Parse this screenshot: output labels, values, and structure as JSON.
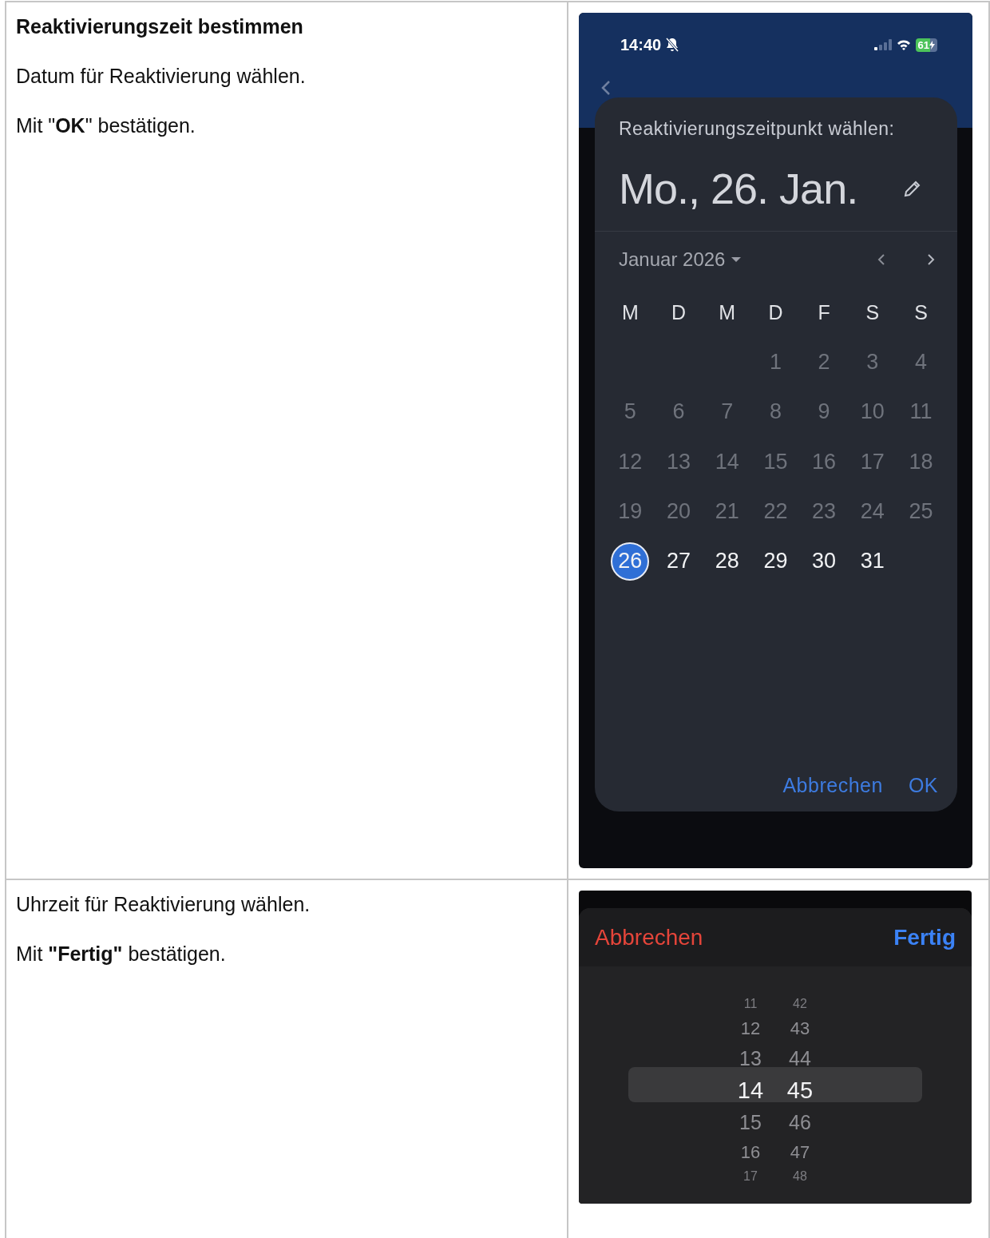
{
  "steps": [
    {
      "kind": "date",
      "heading": "Reaktivierungszeit bestimmen",
      "paragraphs": [
        "Datum für Reaktivierung wählen.",
        "Mit \"**OK**\" bestätigen."
      ],
      "phone": {
        "status_time": "14:40",
        "battery": "61",
        "dialog": {
          "title": "Reaktivierungszeitpunkt wählen:",
          "date": "Mo., 26. Jan.",
          "month": "Januar 2026",
          "weekdays": [
            "M",
            "D",
            "M",
            "D",
            "F",
            "S",
            "S"
          ],
          "weeks": [
            [
              {
                "day": "1",
                "disabled": true,
                "selected": false
              },
              {
                "day": "2",
                "disabled": true,
                "selected": false
              },
              {
                "day": "3",
                "disabled": true,
                "selected": false
              },
              {
                "day": "4",
                "disabled": true,
                "selected": false
              }
            ],
            [
              {
                "day": "5",
                "disabled": true,
                "selected": false
              },
              {
                "day": "6",
                "disabled": true,
                "selected": false
              },
              {
                "day": "7",
                "disabled": true,
                "selected": false
              },
              {
                "day": "8",
                "disabled": true,
                "selected": false
              },
              {
                "day": "9",
                "disabled": true,
                "selected": false
              },
              {
                "day": "10",
                "disabled": true,
                "selected": false
              },
              {
                "day": "11",
                "disabled": true,
                "selected": false
              }
            ],
            [
              {
                "day": "12",
                "disabled": true,
                "selected": false
              },
              {
                "day": "13",
                "disabled": true,
                "selected": false
              },
              {
                "day": "14",
                "disabled": true,
                "selected": false
              },
              {
                "day": "15",
                "disabled": true,
                "selected": false
              },
              {
                "day": "16",
                "disabled": true,
                "selected": false
              },
              {
                "day": "17",
                "disabled": true,
                "selected": false
              },
              {
                "day": "18",
                "disabled": true,
                "selected": false
              }
            ],
            [
              {
                "day": "19",
                "disabled": true,
                "selected": false
              },
              {
                "day": "20",
                "disabled": true,
                "selected": false
              },
              {
                "day": "21",
                "disabled": true,
                "selected": false
              },
              {
                "day": "22",
                "disabled": true,
                "selected": false
              },
              {
                "day": "23",
                "disabled": true,
                "selected": false
              },
              {
                "day": "24",
                "disabled": true,
                "selected": false
              },
              {
                "day": "25",
                "disabled": true,
                "selected": false
              }
            ],
            [
              {
                "day": "26",
                "disabled": false,
                "selected": true
              },
              {
                "day": "27",
                "disabled": false,
                "selected": false
              },
              {
                "day": "28",
                "disabled": false,
                "selected": false
              },
              {
                "day": "29",
                "disabled": false,
                "selected": false
              },
              {
                "day": "30",
                "disabled": false,
                "selected": false
              },
              {
                "day": "31",
                "disabled": false,
                "selected": false
              }
            ]
          ],
          "buttons": [
            "Abbrechen",
            "OK"
          ]
        }
      }
    },
    {
      "kind": "time",
      "paragraphs": [
        "Uhrzeit für Reaktivierung wählen.",
        "Mit **\"Fertig\"** bestätigen."
      ],
      "picker": {
        "cancel": "Abbrechen",
        "done": "Fertig",
        "hours": [
          {
            "value": "11",
            "selected": false
          },
          {
            "value": "12",
            "selected": false
          },
          {
            "value": "13",
            "selected": false
          },
          {
            "value": "14",
            "selected": true
          },
          {
            "value": "15",
            "selected": false
          },
          {
            "value": "16",
            "selected": false
          },
          {
            "value": "17",
            "selected": false
          }
        ],
        "minutes": [
          {
            "value": "42",
            "selected": false
          },
          {
            "value": "43",
            "selected": false
          },
          {
            "value": "44",
            "selected": false
          },
          {
            "value": "45",
            "selected": true
          },
          {
            "value": "46",
            "selected": false
          },
          {
            "value": "47",
            "selected": false
          },
          {
            "value": "48",
            "selected": false
          }
        ]
      }
    }
  ]
}
